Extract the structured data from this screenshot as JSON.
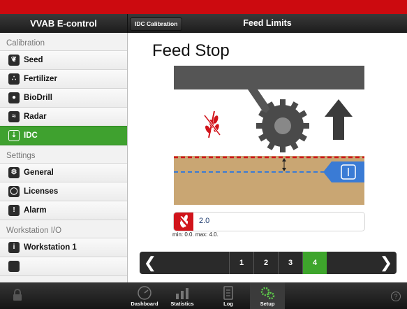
{
  "header": {
    "app_title": "VVAB E-control",
    "back_button": "IDC Calibration",
    "page_title": "Feed Limits"
  },
  "sidebar": {
    "sections": [
      {
        "title": "Calibration",
        "items": [
          {
            "label": "Seed",
            "icon": "seed-icon"
          },
          {
            "label": "Fertilizer",
            "icon": "fertilizer-icon"
          },
          {
            "label": "BioDrill",
            "icon": "biodrill-icon"
          },
          {
            "label": "Radar",
            "icon": "radar-icon"
          },
          {
            "label": "IDC",
            "icon": "idc-icon",
            "active": true
          }
        ]
      },
      {
        "title": "Settings",
        "items": [
          {
            "label": "General",
            "icon": "general-icon"
          },
          {
            "label": "Licenses",
            "icon": "licenses-icon"
          },
          {
            "label": "Alarm",
            "icon": "alarm-icon"
          }
        ]
      },
      {
        "title": "Workstation I/O",
        "items": [
          {
            "label": "Workstation 1",
            "icon": "workstation-icon"
          }
        ]
      }
    ]
  },
  "main": {
    "heading": "Feed Stop",
    "value": "2.0",
    "range": "min: 0.0. max: 4.0."
  },
  "pager": {
    "prev": "❮",
    "next": "❯",
    "pages": [
      "1",
      "2",
      "3",
      "4"
    ],
    "selected": "4"
  },
  "tabbar": {
    "tabs": [
      {
        "label": "Dashboard",
        "icon": "dashboard-icon"
      },
      {
        "label": "Statistics",
        "icon": "statistics-icon"
      },
      {
        "label": "Log",
        "icon": "log-icon"
      },
      {
        "label": "Setup",
        "icon": "setup-icon",
        "selected": true
      }
    ],
    "help": "?"
  },
  "colors": {
    "brand_red": "#cc0a0f",
    "active_green": "#3fa12f",
    "dark_bar": "#2a2a2a"
  }
}
